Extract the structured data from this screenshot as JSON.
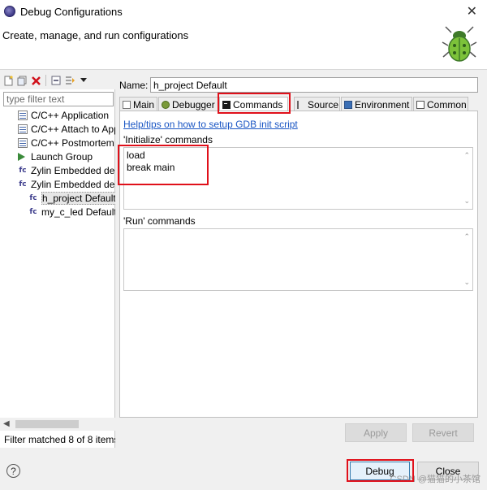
{
  "window": {
    "title": "Debug Configurations",
    "close_label": "✕"
  },
  "header": {
    "heading": "Create, manage, and run configurations"
  },
  "left": {
    "toolbar": [
      {
        "name": "new-config-icon",
        "glyph": "📄"
      },
      {
        "name": "duplicate-icon",
        "glyph": "❐"
      },
      {
        "name": "delete-icon",
        "glyph": "✖"
      },
      {
        "name": "collapse-all-icon",
        "glyph": "⊟"
      },
      {
        "name": "filter-icon",
        "glyph": "⇶"
      },
      {
        "name": "dropdown-icon",
        "glyph": "▾"
      }
    ],
    "filter_placeholder": "type filter text",
    "tree": [
      {
        "label": "C/C++ Application",
        "icon": "cpp",
        "level": 0
      },
      {
        "label": "C/C++ Attach to Application",
        "icon": "cpp",
        "level": 0
      },
      {
        "label": "C/C++ Postmortem Debugger",
        "icon": "cpp",
        "level": 0
      },
      {
        "label": "Launch Group",
        "icon": "launch",
        "level": 0
      },
      {
        "label": "Zylin Embedded debug (Cygwin)",
        "icon": "fc",
        "level": 0
      },
      {
        "label": "Zylin Embedded debug (Native)",
        "icon": "fc",
        "level": 0
      },
      {
        "label": "h_project Default",
        "icon": "fc",
        "level": 1,
        "selected": true
      },
      {
        "label": "my_c_led Default",
        "icon": "fc",
        "level": 1
      }
    ],
    "filter_status": "Filter matched 8 of 8 items"
  },
  "right": {
    "name_label": "Name:",
    "name_value": "h_project Default",
    "tabs": [
      {
        "label": "Main",
        "icon": "main"
      },
      {
        "label": "Debugger",
        "icon": "debugger"
      },
      {
        "label": "Commands",
        "icon": "commands",
        "active": true
      },
      {
        "label": "Source",
        "icon": "source"
      },
      {
        "label": "Environment",
        "icon": "environment"
      },
      {
        "label": "Common",
        "icon": "common"
      }
    ],
    "help_link": "Help/tips on how to setup GDB init script",
    "initialize_label": "'Initialize' commands",
    "initialize_commands": [
      "load",
      "break main"
    ],
    "run_label": "'Run' commands",
    "run_commands": [],
    "apply_label": "Apply",
    "revert_label": "Revert"
  },
  "bottom": {
    "help_glyph": "?",
    "debug_label": "Debug",
    "close_label": "Close",
    "watermark": "CSDN @猫猫的小茶馆"
  },
  "colors": {
    "highlight_box": "#e0101a",
    "link": "#1a56c4"
  }
}
